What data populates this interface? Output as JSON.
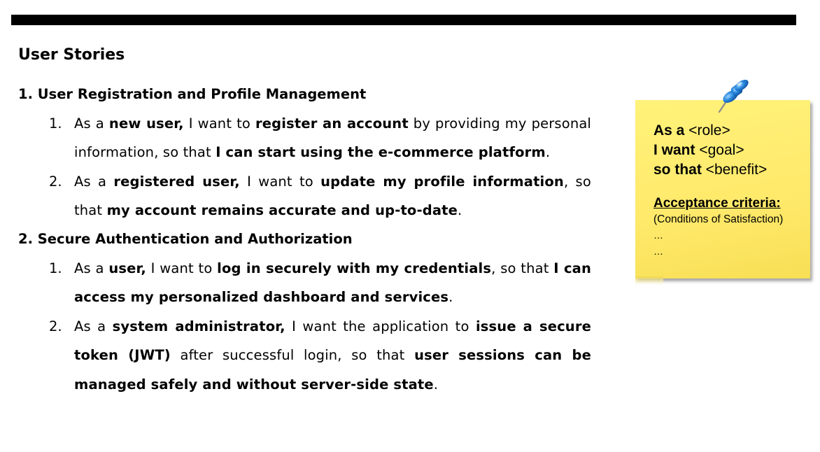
{
  "heading": "User Stories",
  "sections": [
    {
      "title": "1. User Registration and Profile Management",
      "stories": [
        {
          "num": "1.",
          "parts": [
            "As a ",
            "new user,",
            " I want to ",
            "register an account",
            " by providing my personal information, so that ",
            "I can start using the e-commerce platform",
            "."
          ]
        },
        {
          "num": "2.",
          "parts": [
            "As a ",
            "registered user,",
            " I want to ",
            "update my profile information",
            ", so that ",
            "my account remains accurate and up-to-date",
            "."
          ]
        }
      ]
    },
    {
      "title": "2. Secure Authentication and Authorization",
      "stories": [
        {
          "num": "1.",
          "parts": [
            "As a ",
            "user,",
            " I want to ",
            "log in securely with my credentials",
            ", so that ",
            "I can access my personalized dashboard and services",
            "."
          ]
        },
        {
          "num": "2.",
          "parts": [
            "As a ",
            "system administrator,",
            " I want the application to ",
            "issue a secure token (JWT)",
            " after successful login, so that ",
            "user sessions can be managed safely and without server-side state",
            "."
          ]
        }
      ]
    }
  ],
  "note": {
    "line1_bold": "As a",
    "line1_rest": " <role>",
    "line2_bold": "I want",
    "line2_rest": " <goal>",
    "line3_bold": "so that",
    "line3_rest": " <benefit>",
    "acceptance": "Acceptance criteria:",
    "conditions": "(Conditions of Satisfaction)",
    "dots1": "…",
    "dots2": "…"
  },
  "colors": {
    "note_yellow": "#fff06e",
    "pin_blue": "#1e7fd6",
    "bar": "#000000"
  },
  "icons": {
    "pin": "push-pin-icon"
  }
}
